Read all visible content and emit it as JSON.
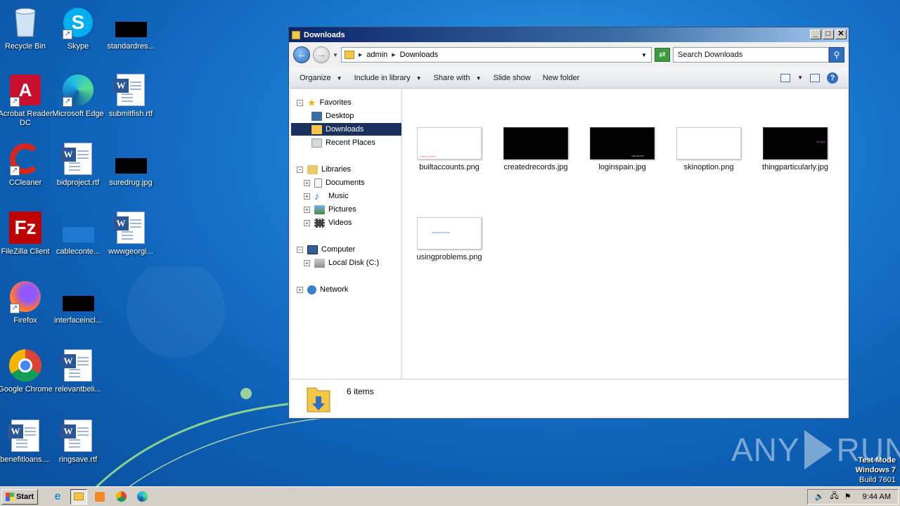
{
  "desktop": {
    "icons": [
      {
        "label": "Recycle Bin",
        "icon": "recycle-bin-icon"
      },
      {
        "label": "Skype",
        "icon": "skype-icon"
      },
      {
        "label": "standardres...",
        "icon": "image-file-icon"
      },
      {
        "label": "Acrobat Reader DC",
        "icon": "acrobat-icon"
      },
      {
        "label": "Microsoft Edge",
        "icon": "edge-icon"
      },
      {
        "label": "submitfish.rtf",
        "icon": "word-doc-icon"
      },
      {
        "label": "CCleaner",
        "icon": "ccleaner-icon"
      },
      {
        "label": "bidproject.rtf",
        "icon": "word-doc-icon"
      },
      {
        "label": "suredrug.jpg",
        "icon": "image-file-icon"
      },
      {
        "label": "FileZilla Client",
        "icon": "filezilla-icon"
      },
      {
        "label": "cableconte...",
        "icon": "image-file-icon"
      },
      {
        "label": "wwwgeorgi...",
        "icon": "word-doc-icon"
      },
      {
        "label": "Firefox",
        "icon": "firefox-icon"
      },
      {
        "label": "interfaceincl...",
        "icon": "image-file-icon"
      },
      {
        "label": "Google Chrome",
        "icon": "chrome-icon"
      },
      {
        "label": "relevantbeli...",
        "icon": "word-doc-icon"
      },
      {
        "label": "benefitloans....",
        "icon": "word-doc-icon"
      },
      {
        "label": "ringsave.rtf",
        "icon": "word-doc-icon"
      }
    ]
  },
  "explorer": {
    "title": "Downloads",
    "address": {
      "segments": [
        "admin",
        "Downloads"
      ]
    },
    "search_placeholder": "Search Downloads",
    "toolbar": {
      "organize": "Organize",
      "include": "Include in library",
      "share": "Share with",
      "slideshow": "Slide show",
      "newfolder": "New folder"
    },
    "nav": {
      "favorites": "Favorites",
      "desktop": "Desktop",
      "downloads": "Downloads",
      "recent": "Recent Places",
      "libraries": "Libraries",
      "documents": "Documents",
      "music": "Music",
      "pictures": "Pictures",
      "videos": "Videos",
      "computer": "Computer",
      "localdisk": "Local Disk (C:)",
      "network": "Network"
    },
    "files": [
      {
        "name": "builtaccounts.png",
        "thumb": "white",
        "caption": "builtaccounts"
      },
      {
        "name": "createdrecords.jpg",
        "thumb": "black",
        "caption": ""
      },
      {
        "name": "loginspain.jpg",
        "thumb": "black",
        "caption": "loginspain"
      },
      {
        "name": "skinoption.png",
        "thumb": "white",
        "caption": ""
      },
      {
        "name": "thingparticularly.jpg",
        "thumb": "black",
        "caption": "thingpa"
      },
      {
        "name": "usingproblems.png",
        "thumb": "white",
        "caption": "usingproblems"
      }
    ],
    "status": "6 items"
  },
  "taskbar": {
    "start": "Start",
    "clock": "9:44 AM"
  },
  "watermark": {
    "left": "ANY",
    "right": "RUN"
  },
  "testmode": {
    "line1": "Test Mode",
    "line2": "Windows 7",
    "line3": "Build 7601"
  },
  "colors": {
    "desktop_bg": "#1a78cf",
    "titlebar": "#0b246a",
    "selection": "#1a315f"
  }
}
